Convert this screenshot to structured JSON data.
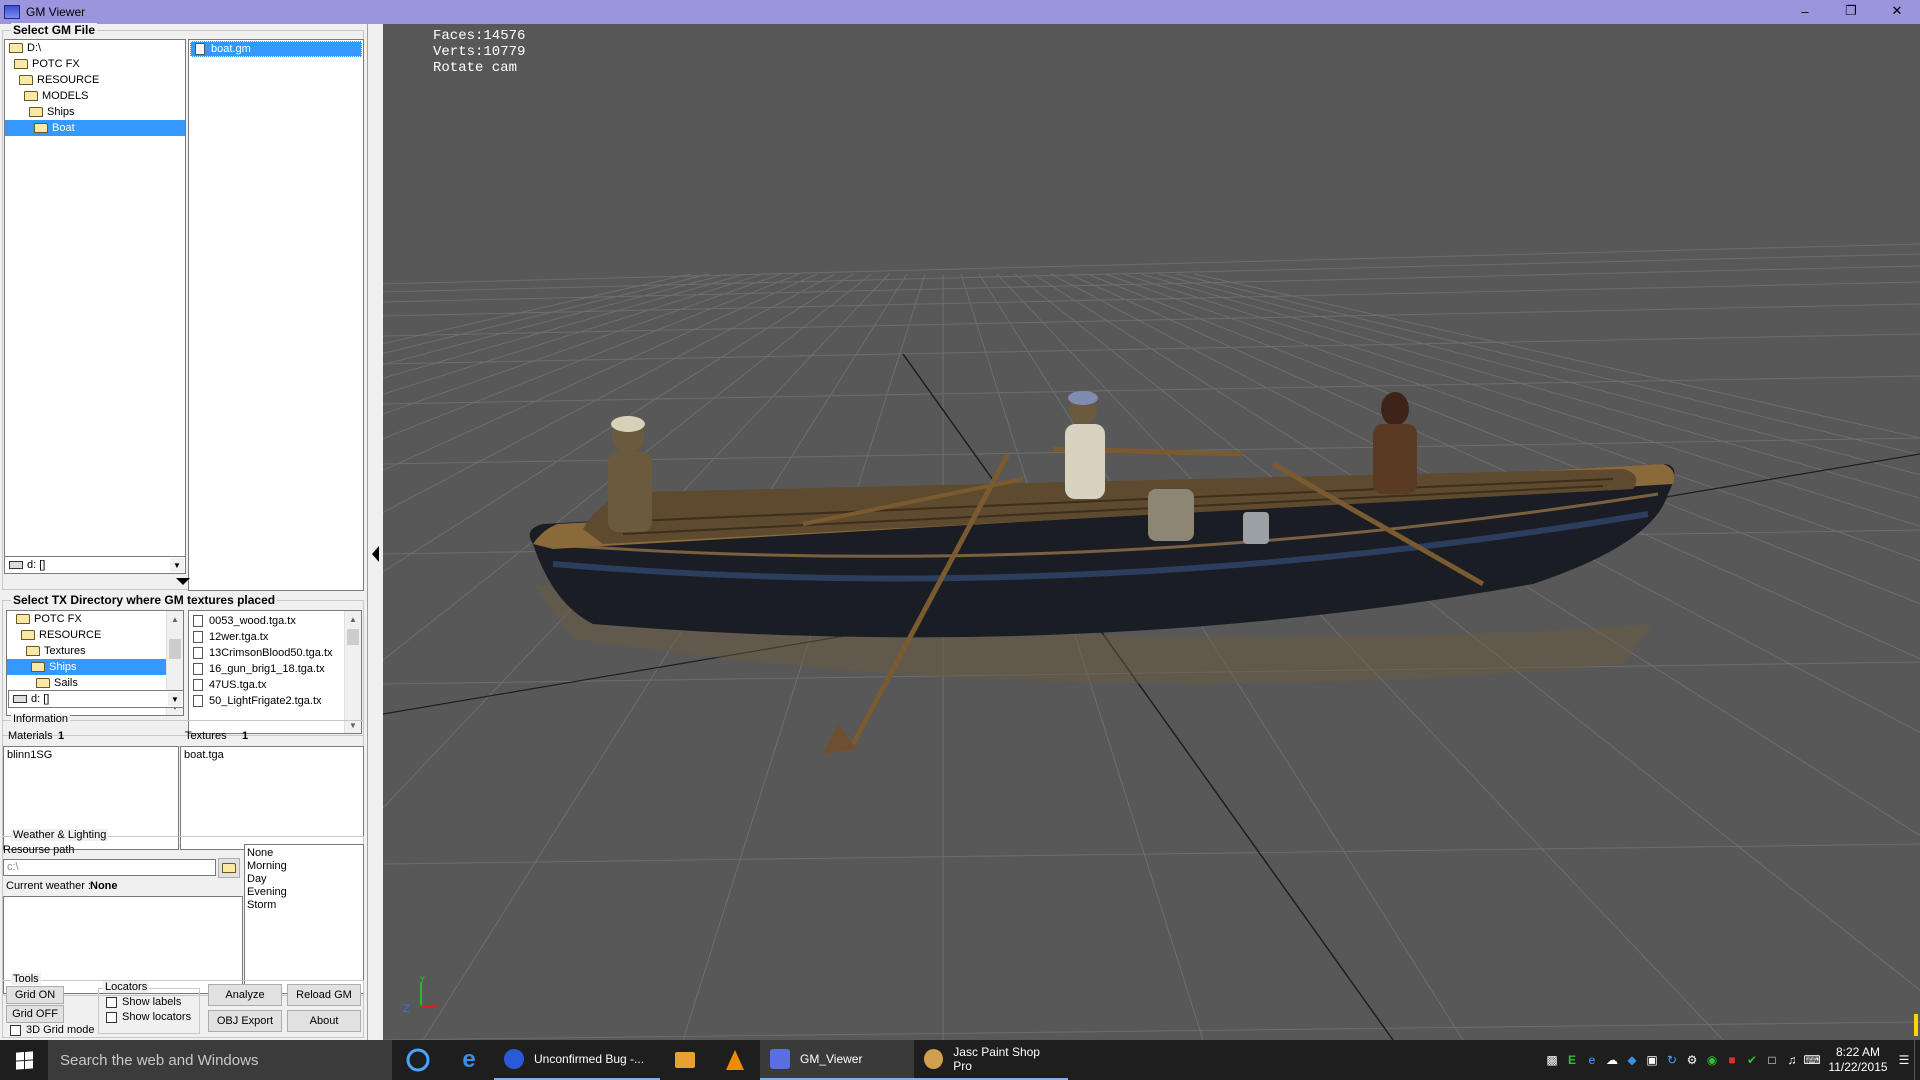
{
  "window": {
    "title": "GM Viewer",
    "minimize": "–",
    "maximize": "❐",
    "close": "✕"
  },
  "select_gm": {
    "legend": "Select GM File",
    "tree": [
      {
        "label": "D:\\",
        "indent": 0,
        "selected": false
      },
      {
        "label": "POTC FX",
        "indent": 1,
        "selected": false
      },
      {
        "label": "RESOURCE",
        "indent": 2,
        "selected": false
      },
      {
        "label": "MODELS",
        "indent": 3,
        "selected": false
      },
      {
        "label": "Ships",
        "indent": 4,
        "selected": false
      },
      {
        "label": "Boat",
        "indent": 5,
        "selected": true
      }
    ],
    "files": [
      {
        "label": "boat.gm",
        "selected": true
      }
    ],
    "drive": "d: []"
  },
  "select_tx": {
    "legend": "Select TX Directory where GM textures placed",
    "tree": [
      {
        "label": "POTC FX",
        "indent": 1,
        "selected": false
      },
      {
        "label": "RESOURCE",
        "indent": 2,
        "selected": false
      },
      {
        "label": "Textures",
        "indent": 3,
        "selected": false
      },
      {
        "label": "Ships",
        "indent": 4,
        "selected": true
      },
      {
        "label": "Sails",
        "indent": 5,
        "selected": false
      }
    ],
    "files": [
      "0053_wood.tga.tx",
      "12wer.tga.tx",
      "13CrimsonBlood50.tga.tx",
      "16_gun_brig1_18.tga.tx",
      "47US.tga.tx",
      "50_LightFrigate2.tga.tx"
    ],
    "drive": "d: []"
  },
  "information": {
    "legend": "Information",
    "materials_label": "Materials",
    "materials_count": "1",
    "textures_label": "Textures",
    "textures_count": "1",
    "materials": [
      "blinn1SG"
    ],
    "textures": [
      "boat.tga"
    ]
  },
  "weather": {
    "legend": "Weather & Lighting",
    "resource_path_label": "Resourse path",
    "resource_path_value": "c:\\",
    "current_weather_label": "Current weather :",
    "current_weather_value": "None",
    "options": [
      "None",
      "Morning",
      "Day",
      "Evening",
      "Storm"
    ]
  },
  "tools": {
    "legend": "Tools",
    "grid_on": "Grid ON",
    "grid_off": "Grid OFF",
    "grid_3d": "3D Grid mode",
    "locators_legend": "Locators",
    "show_labels": "Show labels",
    "show_locators": "Show locators",
    "analyze": "Analyze",
    "reload_gm": "Reload GM",
    "obj_export": "OBJ Export",
    "about": "About"
  },
  "viewport": {
    "hud": [
      "Faces:14576",
      "Verts:10779",
      "Rotate cam"
    ],
    "axis_z": "Z",
    "axis_y": "Y"
  },
  "taskbar": {
    "search_placeholder": "Search the web and Windows",
    "apps": [
      {
        "label": "Unconfirmed Bug -...",
        "icon": "browser-icon",
        "active": false
      },
      {
        "label": "GM_Viewer",
        "icon": "gm-viewer-icon",
        "active": true
      },
      {
        "label": "Jasc Paint Shop Pro",
        "icon": "paint-shop-icon",
        "active": false
      }
    ],
    "time": "8:22 AM",
    "date": "11/22/2015"
  },
  "colors": {
    "titlebar": "#9a95dd",
    "selection": "#3399ff",
    "viewport_bg": "#585858",
    "taskbar": "#1e1e1e"
  }
}
